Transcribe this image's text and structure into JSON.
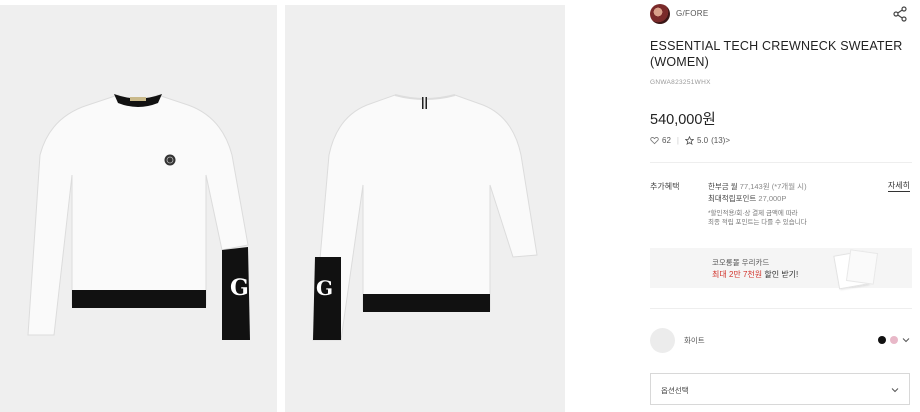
{
  "product": {
    "brand": "G/FORE",
    "title": "ESSENTIAL TECH CREWNECK SWEATER (WOMEN)",
    "code": "GNWA823251WHX",
    "price": "540,000원",
    "likes": "62",
    "rating": "5.0",
    "reviews": "(13)>"
  },
  "benefits": {
    "label": "추가혜택",
    "detail_link": "자세히",
    "installment_prefix": "한부금 월",
    "installment_value": "77,143원 (*7개월 시)",
    "points_prefix": "최대적립포인트",
    "points_value": "27,000P",
    "note1": "*할인적용/회·상 결제 금액에 따라",
    "note2": "최종 적립 포인트는 다를 수 있습니다"
  },
  "card_banner": {
    "line1": "코오롱몰 우리카드",
    "line2_highlight": "최대 2만 7천원",
    "line2_rest": " 할인 받기!"
  },
  "color": {
    "selected_name": "화이트",
    "swatches": [
      "#111111",
      "#e8b8c8"
    ]
  },
  "option": {
    "placeholder": "옵션선택"
  },
  "icons": [
    "share-icon",
    "heart-icon",
    "star-icon",
    "chevron-down-icon"
  ],
  "colors": {
    "accent_red": "#d2332b",
    "sweater": "#fafafa",
    "trim": "#111111"
  }
}
